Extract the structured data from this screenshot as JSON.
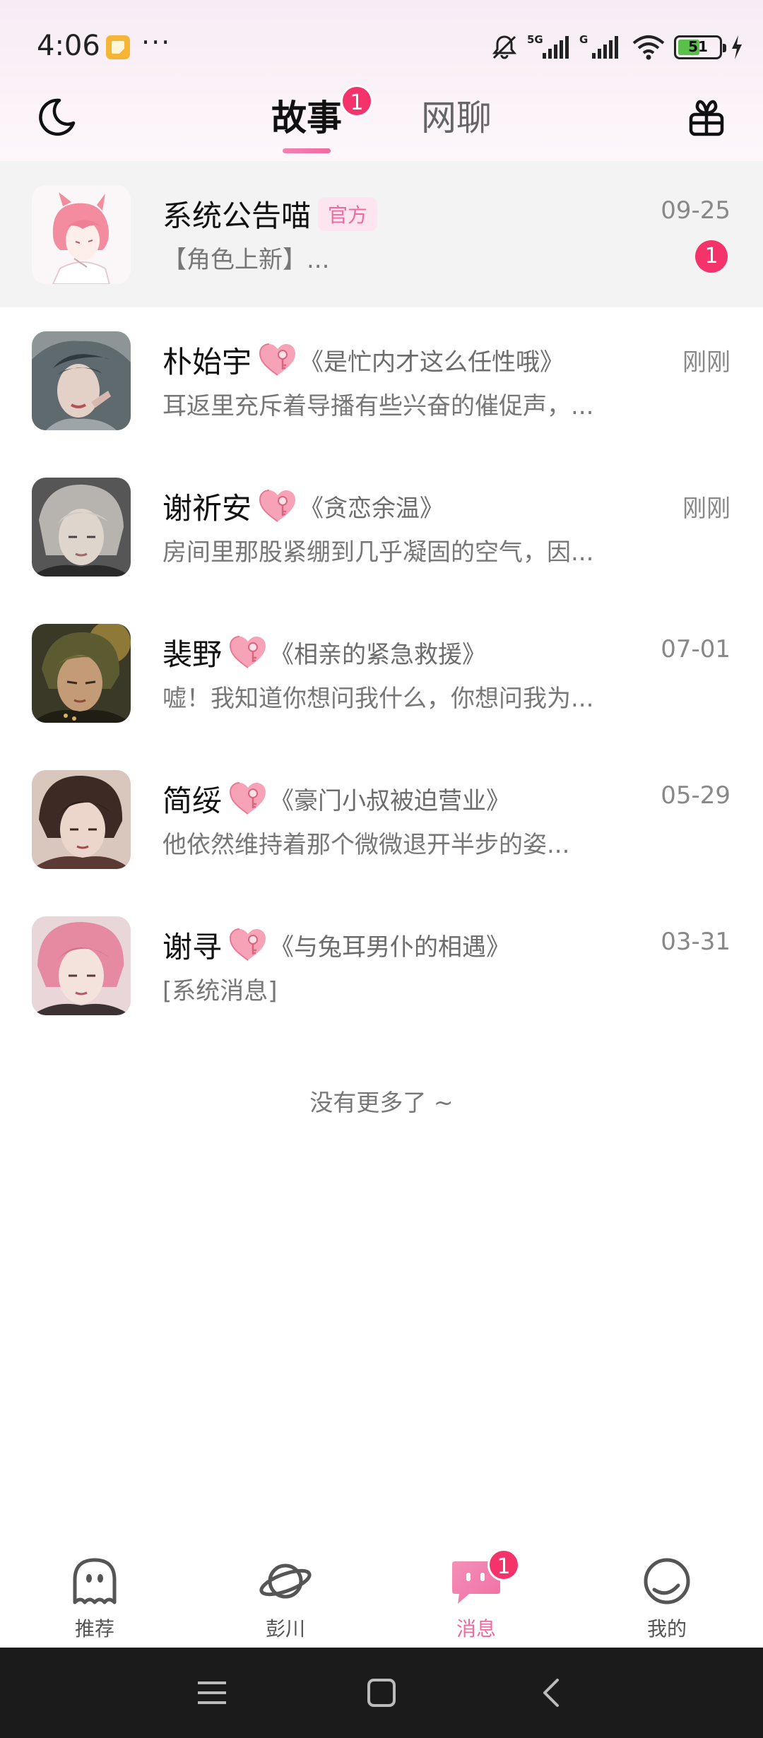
{
  "status_bar": {
    "time": "4:06",
    "dots": "···",
    "battery": "51"
  },
  "header": {
    "tabs": [
      {
        "label": "故事",
        "active": true,
        "badge": "1"
      },
      {
        "label": "网聊",
        "active": false
      }
    ]
  },
  "conversations": [
    {
      "name": "系统公告喵",
      "tag": "官方",
      "story": "",
      "preview": "【角色上新】...",
      "time": "09-25",
      "unread": "1",
      "pinned": true
    },
    {
      "name": "朴始宇",
      "story": "《是忙内才这么任性哦》",
      "preview": "耳返里充斥着导播有些兴奋的催促声，...",
      "time": "刚刚"
    },
    {
      "name": "谢祈安",
      "story": "《贪恋余温》",
      "preview": "房间里那股紧绷到几乎凝固的空气，因...",
      "time": "刚刚"
    },
    {
      "name": "裴野",
      "story": "《相亲的紧急救援》",
      "preview": "嘘！我知道你想问我什么，你想问我为...",
      "time": "07-01"
    },
    {
      "name": "简绥",
      "story": "《豪门小叔被迫营业》",
      "preview": "他依然维持着那个微微退开半步的姿...",
      "time": "05-29"
    },
    {
      "name": "谢寻",
      "story": "《与兔耳男仆的相遇》",
      "preview": "[系统消息]",
      "time": "03-31"
    }
  ],
  "list_footer": "没有更多了 ~",
  "bottom_nav": [
    {
      "label": "推荐",
      "icon": "ghost-icon"
    },
    {
      "label": "彭川",
      "icon": "planet-icon"
    },
    {
      "label": "消息",
      "icon": "message-icon",
      "active": true,
      "badge": "1"
    },
    {
      "label": "我的",
      "icon": "smile-icon"
    }
  ],
  "colors": {
    "accent": "#f06aa0",
    "badge": "#f5336b"
  }
}
